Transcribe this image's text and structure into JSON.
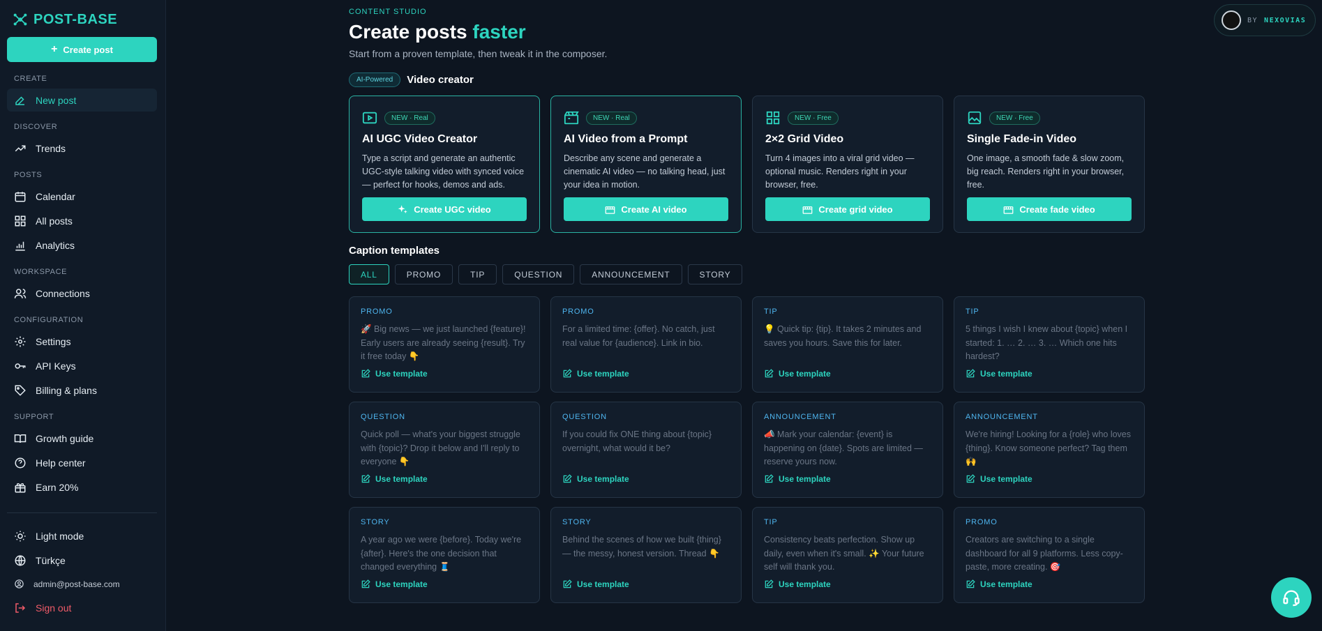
{
  "brand": {
    "name": "POST-BASE"
  },
  "sidebar": {
    "create_label": "Create post",
    "sections": {
      "create": "CREATE",
      "discover": "DISCOVER",
      "posts": "POSTS",
      "workspace": "WORKSPACE",
      "configuration": "CONFIGURATION",
      "support": "SUPPORT"
    },
    "items": {
      "new_post": "New post",
      "trends": "Trends",
      "calendar": "Calendar",
      "all_posts": "All posts",
      "analytics": "Analytics",
      "connections": "Connections",
      "settings": "Settings",
      "api_keys": "API Keys",
      "billing": "Billing & plans",
      "growth_guide": "Growth guide",
      "help_center": "Help center",
      "earn": "Earn 20%"
    },
    "footer": {
      "light_mode": "Light mode",
      "language": "Türkçe",
      "email": "admin@post-base.com",
      "sign_out": "Sign out"
    }
  },
  "header": {
    "eyebrow": "CONTENT STUDIO",
    "title_main": "Create posts",
    "title_accent": "faster",
    "subtitle": "Start from a proven template, then tweak it in the composer."
  },
  "video": {
    "badge": "AI-Powered",
    "label": "Video creator",
    "cards": [
      {
        "icon": "play-video-icon",
        "tag": "NEW · Real",
        "title": "AI UGC Video Creator",
        "desc": "Type a script and generate an authentic UGC-style talking video with synced voice — perfect for hooks, demos and ads.",
        "button": "Create UGC video"
      },
      {
        "icon": "clapperboard-icon",
        "tag": "NEW · Real",
        "title": "AI Video from a Prompt",
        "desc": "Describe any scene and generate a cinematic AI video — no talking head, just your idea in motion.",
        "button": "Create AI video"
      },
      {
        "icon": "grid-icon",
        "tag": "NEW · Free",
        "title": "2×2 Grid Video",
        "desc": "Turn 4 images into a viral grid video — optional music. Renders right in your browser, free.",
        "button": "Create grid video"
      },
      {
        "icon": "image-icon",
        "tag": "NEW · Free",
        "title": "Single Fade-in Video",
        "desc": "One image, a smooth fade & slow zoom, big reach. Renders right in your browser, free.",
        "button": "Create fade video"
      }
    ]
  },
  "captions": {
    "title": "Caption templates",
    "filters": [
      "ALL",
      "PROMO",
      "TIP",
      "QUESTION",
      "ANNOUNCEMENT",
      "STORY"
    ],
    "use_label": "Use template",
    "templates": [
      {
        "cat": "PROMO",
        "text": "🚀 Big news — we just launched {feature}! Early users are already seeing {result}. Try it free today 👇"
      },
      {
        "cat": "PROMO",
        "text": "For a limited time: {offer}. No catch, just real value for {audience}. Link in bio."
      },
      {
        "cat": "TIP",
        "text": "💡 Quick tip: {tip}. It takes 2 minutes and saves you hours. Save this for later."
      },
      {
        "cat": "TIP",
        "text": "5 things I wish I knew about {topic} when I started: 1. … 2. … 3. … Which one hits hardest?"
      },
      {
        "cat": "QUESTION",
        "text": "Quick poll — what's your biggest struggle with {topic}? Drop it below and I'll reply to everyone 👇"
      },
      {
        "cat": "QUESTION",
        "text": "If you could fix ONE thing about {topic} overnight, what would it be?"
      },
      {
        "cat": "ANNOUNCEMENT",
        "text": "📣 Mark your calendar: {event} is happening on {date}. Spots are limited — reserve yours now."
      },
      {
        "cat": "ANNOUNCEMENT",
        "text": "We're hiring! Looking for a {role} who loves {thing}. Know someone perfect? Tag them 🙌"
      },
      {
        "cat": "STORY",
        "text": "A year ago we were {before}. Today we're {after}. Here's the one decision that changed everything 🧵"
      },
      {
        "cat": "STORY",
        "text": "Behind the scenes of how we built {thing} — the messy, honest version. Thread 👇"
      },
      {
        "cat": "TIP",
        "text": "Consistency beats perfection. Show up daily, even when it's small. ✨ Your future self will thank you."
      },
      {
        "cat": "PROMO",
        "text": "Creators are switching to a single dashboard for all 9 platforms. Less copy-paste, more creating. 🎯"
      }
    ]
  },
  "badge": {
    "by": "BY",
    "name": "NEXOVIAS"
  },
  "colors": {
    "accent": "#2dd4bf",
    "background": "#0d1520",
    "card": "#121d2b",
    "danger": "#f05b68"
  }
}
